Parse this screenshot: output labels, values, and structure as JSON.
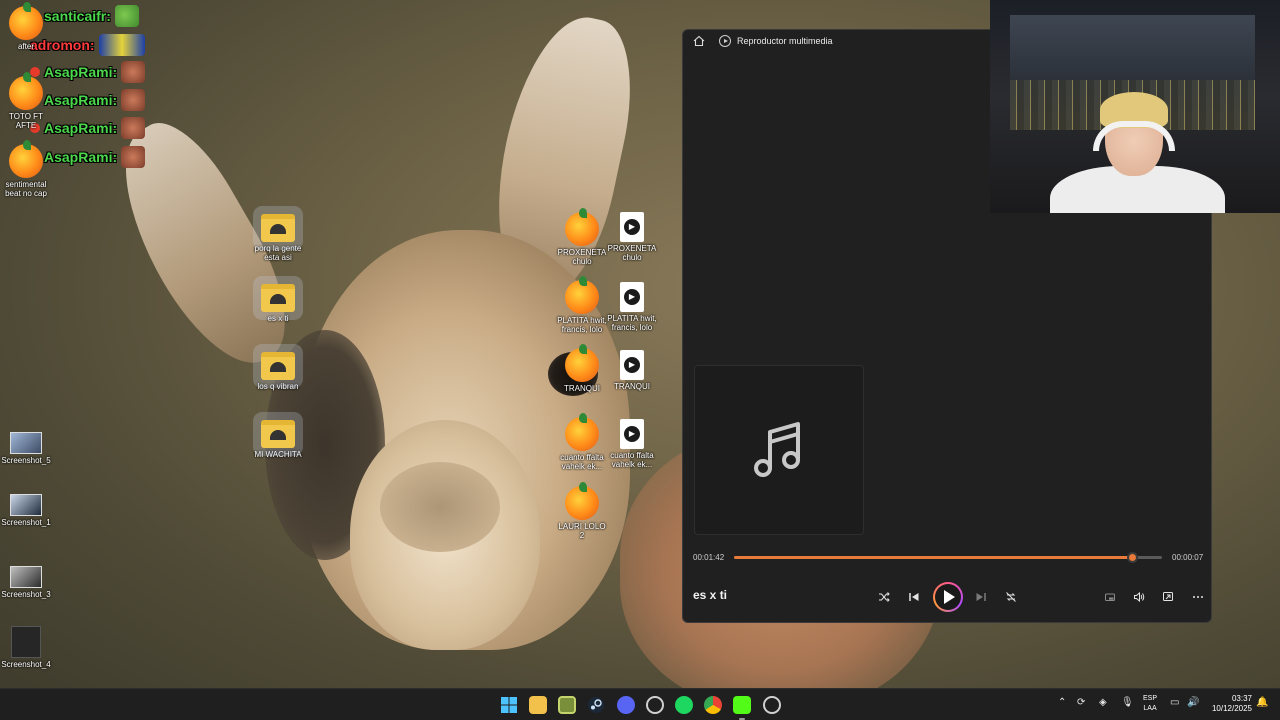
{
  "chat": {
    "messages": [
      {
        "user": "santicaifr:",
        "color": "#4cd84c",
        "emote": "pepe-emote"
      },
      {
        "user": "adromon:",
        "color": "#ff3b3b",
        "emote": "car-emote"
      },
      {
        "user": "AsapRami:",
        "color": "#4cd84c",
        "emote": "face-emote"
      },
      {
        "user": "AsapRami:",
        "color": "#4cd84c",
        "emote": "face-emote"
      },
      {
        "user": "AsapRami:",
        "color": "#4cd84c",
        "emote": "face-emote"
      },
      {
        "user": "AsapRami:",
        "color": "#4cd84c",
        "emote": "face-emote"
      }
    ],
    "badge_count": "22"
  },
  "desktop": {
    "left_icons": [
      {
        "label": "after",
        "type": "fl-studio-icon"
      },
      {
        "label": "TOTO FT AFTE",
        "type": "fl-studio-icon"
      },
      {
        "label": "sentimental beat no cap",
        "type": "fl-studio-icon"
      }
    ],
    "screenshots": [
      {
        "label": "Screenshot_5"
      },
      {
        "label": "Screenshot_1"
      },
      {
        "label": "Screenshot_3"
      },
      {
        "label": "Screenshot_4"
      }
    ],
    "folders": [
      {
        "label": "porq la gente esta asi"
      },
      {
        "label": "es x ti"
      },
      {
        "label": "los q vibran"
      },
      {
        "label": "MI WACHITA"
      }
    ],
    "fl_projects": [
      {
        "label": "PROXENETA chulo"
      },
      {
        "label": "PLATITA hwit, francis, lolo"
      },
      {
        "label": "TRANQUI"
      },
      {
        "label": "cuanto ffalta vahelk ek..."
      },
      {
        "label": "LAURI LOLO 2"
      }
    ],
    "media_files": [
      {
        "label": "PROXENETA chulo"
      },
      {
        "label": "PLATITA hwit, francis, lolo"
      },
      {
        "label": "TRANQUI"
      },
      {
        "label": "cuanto ffalta vahelk ek..."
      }
    ]
  },
  "player": {
    "app_title": "Reproductor multimedia",
    "elapsed": "00:01:42",
    "remaining": "00:00:07",
    "progress": 0.93,
    "song_title": "es x ti",
    "accent": "#e87a3a"
  },
  "taskbar": {
    "lang_line1": "ESP",
    "lang_line2": "LAA",
    "time": "03:37",
    "date": "10/12/2025"
  }
}
